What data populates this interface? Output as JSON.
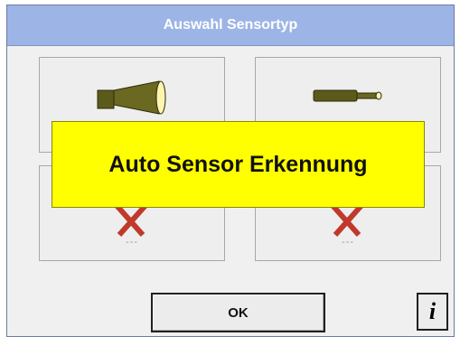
{
  "window": {
    "title": "Auswahl Sensortyp"
  },
  "tiles": [
    {
      "id": "sensor-large",
      "icon": "large-sensor-probe-icon",
      "label": ""
    },
    {
      "id": "sensor-slim",
      "icon": "slim-sensor-probe-icon",
      "label": ""
    },
    {
      "id": "sensor-empty-left",
      "icon": "cross-icon",
      "label": "---"
    },
    {
      "id": "sensor-empty-right",
      "icon": "cross-icon",
      "label": "---"
    }
  ],
  "overlay": {
    "message": "Auto Sensor Erkennung",
    "color": "#ffff00"
  },
  "buttons": {
    "ok_label": "OK",
    "info_label": "i"
  },
  "colors": {
    "titlebar": "#9db5e6",
    "probe_body": "#5c5a1a",
    "cross": "#c0392b"
  }
}
